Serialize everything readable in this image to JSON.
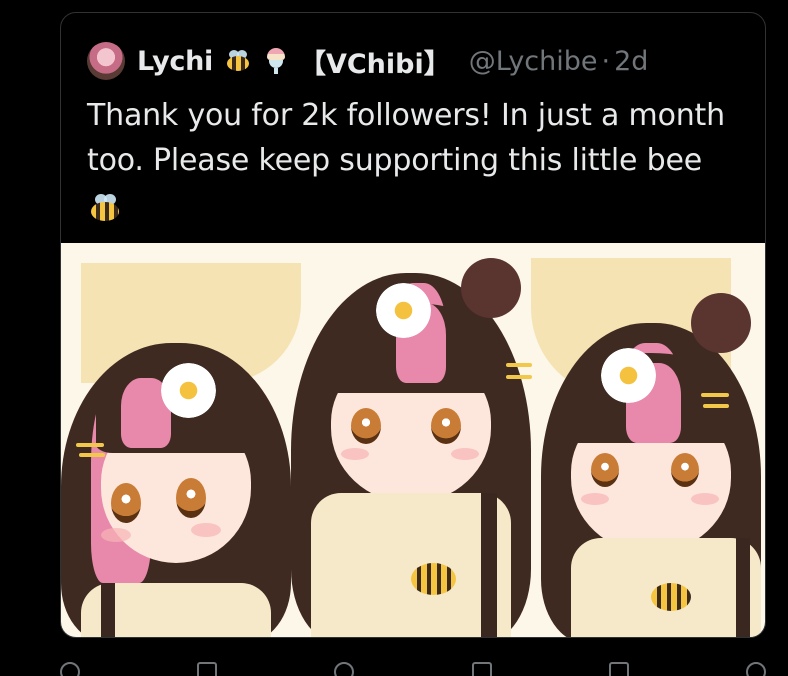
{
  "quoted_tweet": {
    "display_name": "Lychi",
    "emoji_after_name": [
      "bee-icon",
      "parfait-icon"
    ],
    "name_suffix": "【VChibi】",
    "handle": "@Lychibe",
    "separator": "·",
    "time_ago": "2d",
    "text_line_1": "Thank you for 2k followers! In just a month",
    "text_line_2": "too. Please keep supporting this little bee",
    "text_emoji": "bee-icon",
    "media_description_colors": {
      "hair": "#3f2a22",
      "hair_highlight": "#e889ab",
      "background": "#fdf7e9"
    }
  },
  "action_bar": {
    "icons": [
      "reply-icon",
      "retweet-icon",
      "like-icon",
      "views-icon",
      "bookmark-icon",
      "share-icon"
    ]
  },
  "colors": {
    "background": "#000000",
    "text_primary": "#e7e9ea",
    "text_secondary": "#71767b",
    "border": "#2f3336"
  }
}
